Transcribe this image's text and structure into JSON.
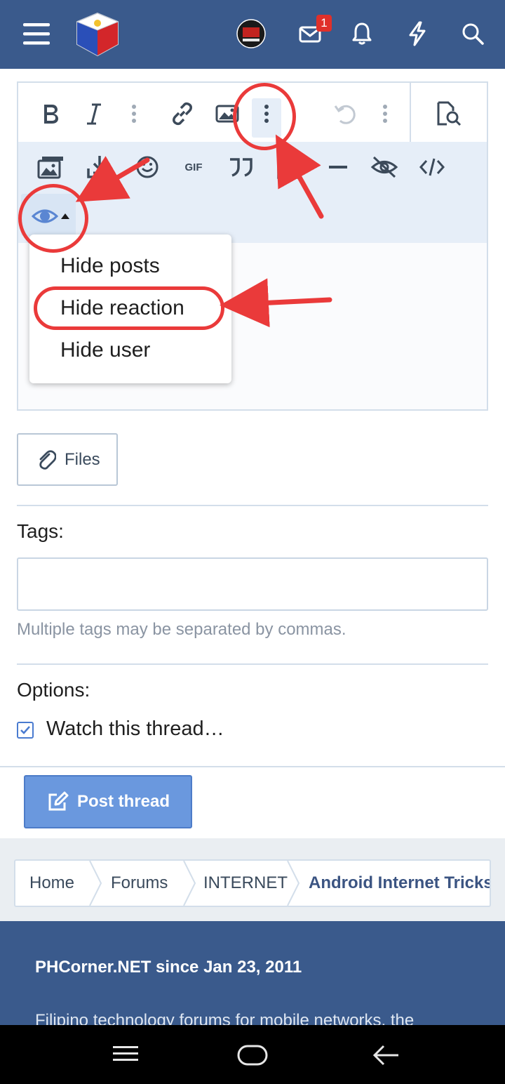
{
  "header": {
    "unread_messages": "1",
    "icons": [
      "menu-icon",
      "site-logo",
      "avatar",
      "mail-icon",
      "bell-icon",
      "lightning-icon",
      "search-icon"
    ]
  },
  "editor": {
    "toolbar_row1": [
      "bold-icon",
      "italic-icon",
      "more-vertical-icon",
      "link-icon",
      "image-icon",
      "more-vertical-icon",
      "undo-icon",
      "more-vertical-icon",
      "preview-icon"
    ],
    "toolbar_row2": [
      "media-icon",
      "insert-icon",
      "smilie-icon",
      "gif-icon",
      "quote-icon",
      "table-icon",
      "hr-icon",
      "spoiler-icon",
      "code-icon",
      "hide-icon"
    ],
    "gif_label": "GIF",
    "hide_menu": {
      "items": [
        "Hide posts",
        "Hide reaction",
        "Hide user"
      ],
      "highlighted": "Hide reaction"
    }
  },
  "files_button": {
    "label": "Files"
  },
  "tags": {
    "label": "Tags:",
    "value": "",
    "hint": "Multiple tags may be separated by commas."
  },
  "options": {
    "label": "Options:",
    "watch_thread": {
      "label": "Watch this thread…",
      "checked": true
    }
  },
  "post_button": {
    "label": "Post thread"
  },
  "breadcrumb": [
    "Home",
    "Forums",
    "INTERNET",
    "Android Internet Tricks"
  ],
  "footer": {
    "title": "PHCorner.NET since Jan 23, 2011",
    "text": "Filipino technology forums for mobile networks, the"
  },
  "colors": {
    "header": "#3a5a8c",
    "accent": "#6a98de",
    "annotation": "#ea3a3a"
  }
}
